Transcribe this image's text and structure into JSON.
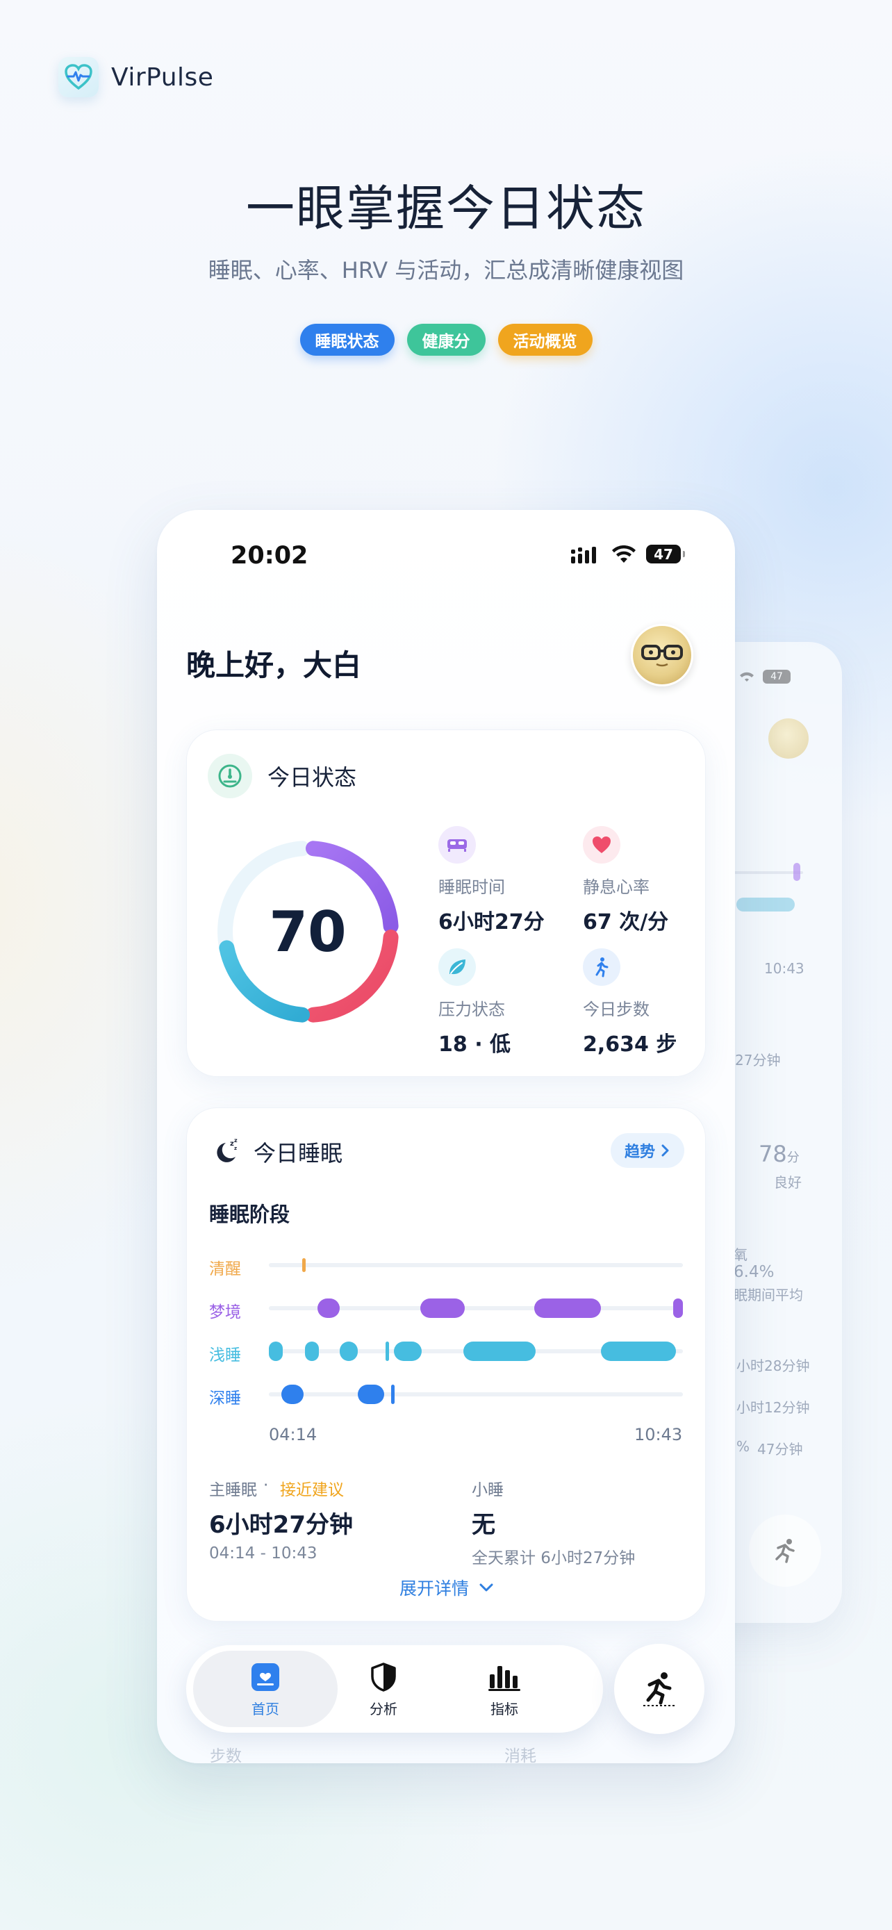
{
  "brand": {
    "name": "VirPulse"
  },
  "hero": {
    "title": "一眼掌握今日状态",
    "subtitle": "睡眠、心率、HRV 与活动，汇总成清晰健康视图",
    "chips": [
      {
        "label": "睡眠状态",
        "color": "#2f80ed"
      },
      {
        "label": "健康分",
        "color": "#3ec59a"
      },
      {
        "label": "活动概览",
        "color": "#f0a51e"
      }
    ]
  },
  "status_bar": {
    "time": "20:02",
    "battery": "47"
  },
  "greeting": "晚上好，大白",
  "today_status": {
    "title": "今日状态",
    "score": "70",
    "metrics": [
      {
        "label": "睡眠时间",
        "value": "6小时27分",
        "icon": "bed-icon",
        "color": "#9b6ae6"
      },
      {
        "label": "静息心率",
        "value": "67 次/分",
        "icon": "heart-icon",
        "color": "#ef4d6b"
      },
      {
        "label": "压力状态",
        "value": "18 · 低",
        "icon": "leaf-icon",
        "color": "#3bb6d6"
      },
      {
        "label": "今日步数",
        "value": "2,634 步",
        "icon": "walk-icon",
        "color": "#2f80ed"
      }
    ]
  },
  "sleep": {
    "title": "今日睡眠",
    "trend_label": "趋势",
    "stages_title": "睡眠阶段",
    "stages": [
      {
        "label": "清醒",
        "color": "#f0a84a"
      },
      {
        "label": "梦境",
        "color": "#9b62e6"
      },
      {
        "label": "浅睡",
        "color": "#46bde0"
      },
      {
        "label": "深睡",
        "color": "#2f80ed"
      }
    ],
    "start_time": "04:14",
    "end_time": "10:43",
    "main_sleep": {
      "label": "主睡眠",
      "badge": "接近建议",
      "value": "6小时27分钟",
      "range": "04:14 - 10:43"
    },
    "nap": {
      "label": "小睡",
      "value": "无",
      "total": "全天累计 6小时27分钟"
    },
    "expand_label": "展开详情"
  },
  "nav": {
    "items": [
      {
        "label": "首页",
        "icon": "home-icon"
      },
      {
        "label": "分析",
        "icon": "shield-icon"
      },
      {
        "label": "指标",
        "icon": "bars-icon"
      }
    ]
  },
  "behind_nav": {
    "left": "步数",
    "right": "消耗"
  },
  "back_phone": {
    "time_label": "10:43",
    "duration_fragment": "27分钟",
    "score_value": "78",
    "score_unit": "分",
    "score_desc": "良好",
    "oxygen_label": "氧",
    "oxygen_value": "6.4%",
    "oxygen_sub": "眠期间平均",
    "row1": "小时28分钟",
    "row2": "小时12分钟",
    "row3_pct": "%",
    "row3_val": "47分钟"
  }
}
